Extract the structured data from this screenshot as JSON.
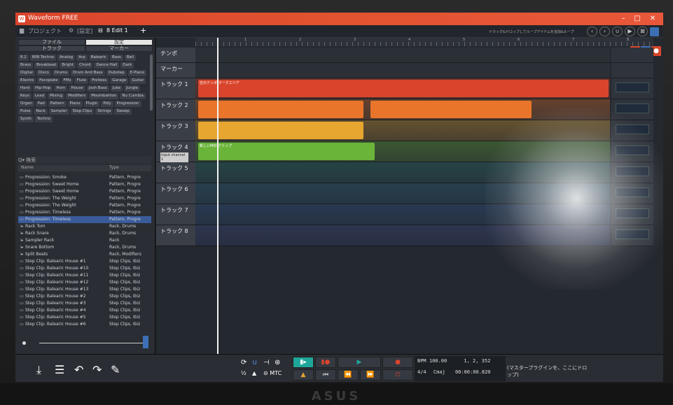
{
  "window": {
    "title": "Waveform FREE"
  },
  "toolbar": {
    "projects": "プロジェクト",
    "settings": "[設定]",
    "edit_tab": "8 Edit 1",
    "add": "+",
    "hint": "ドラッグ&ドロップしてループアイテムを追加&ループ"
  },
  "browser": {
    "tabs_top": [
      "ファイル",
      "設定"
    ],
    "tabs_bottom": [
      "トラック",
      "マーカー"
    ],
    "tags": [
      "8.2",
      "808 Techno",
      "Analog",
      "Arp",
      "Balearic",
      "Bass",
      "Bell",
      "Brass",
      "Breakbeat",
      "Bright",
      "Chord",
      "Dance Hall",
      "Dark",
      "Digital",
      "Disco",
      "Drums",
      "Drum And Bass",
      "Dubstep",
      "E-Piano",
      "Electro",
      "Fecoplate",
      "FMs",
      "Flute",
      "Fretless",
      "Garage",
      "Guitar",
      "Hard",
      "Hip-Hop",
      "Horn",
      "House",
      "Josh Bass",
      "Juke",
      "Jungle",
      "Keys",
      "Lead",
      "Mixing",
      "Modifiers",
      "Moombahton",
      "Nu Cumbia",
      "Organ",
      "Pad",
      "Pattern",
      "Piano",
      "Plugin",
      "Poly",
      "Progression",
      "Pulse",
      "Rack",
      "Sampler",
      "Step Clips",
      "Strings",
      "Sweep",
      "Synth",
      "Techno"
    ],
    "search_label": "検索",
    "columns": [
      "Name",
      "Type"
    ],
    "files": [
      {
        "icon": "pattern",
        "name": "Progression: Smoke",
        "type": "Pattern, Progre"
      },
      {
        "icon": "pattern",
        "name": "Progression: Sweet Home",
        "type": "Pattern, Progre"
      },
      {
        "icon": "pattern",
        "name": "Progression: Sweet Home",
        "type": "Pattern, Progre"
      },
      {
        "icon": "pattern",
        "name": "Progression: The Weight",
        "type": "Pattern, Progre"
      },
      {
        "icon": "pattern",
        "name": "Progression: The Weight",
        "type": "Pattern, Progre"
      },
      {
        "icon": "pattern",
        "name": "Progression: Timeless",
        "type": "Pattern, Progre"
      },
      {
        "icon": "pattern",
        "name": "Progression: Timeless",
        "type": "Pattern, Progre"
      },
      {
        "icon": "rack",
        "name": "Rack Tom",
        "type": "Rack, Drums"
      },
      {
        "icon": "rack",
        "name": "Rack Snare",
        "type": "Rack, Drums"
      },
      {
        "icon": "rack",
        "name": "Sampler Rack",
        "type": "Rack"
      },
      {
        "icon": "rack",
        "name": "Snare Bottom",
        "type": "Rack, Drums"
      },
      {
        "icon": "rack",
        "name": "Split Beats",
        "type": "Rack, Modifiers"
      },
      {
        "icon": "pattern",
        "name": "Step Clip: Balearic House #1",
        "type": "Step Clips, Ibiz"
      },
      {
        "icon": "pattern",
        "name": "Step Clip: Balearic House #10",
        "type": "Step Clips, Ibiz"
      },
      {
        "icon": "pattern",
        "name": "Step Clip: Balearic House #11",
        "type": "Step Clips, Ibiz"
      },
      {
        "icon": "pattern",
        "name": "Step Clip: Balearic House #12",
        "type": "Step Clips, Ibiz"
      },
      {
        "icon": "pattern",
        "name": "Step Clip: Balearic House #13",
        "type": "Step Clips, Ibiz"
      },
      {
        "icon": "pattern",
        "name": "Step Clip: Balearic House #2",
        "type": "Step Clips, Ibiz"
      },
      {
        "icon": "pattern",
        "name": "Step Clip: Balearic House #3",
        "type": "Step Clips, Ibiz"
      },
      {
        "icon": "pattern",
        "name": "Step Clip: Balearic House #4",
        "type": "Step Clips, Ibiz"
      },
      {
        "icon": "pattern",
        "name": "Step Clip: Balearic House #5",
        "type": "Step Clips, Ibiz"
      },
      {
        "icon": "pattern",
        "name": "Step Clip: Balearic House #6",
        "type": "Step Clips, Ibiz"
      }
    ],
    "selected_index": 6
  },
  "arrange": {
    "ruler_labels": [
      "1",
      "2",
      "3",
      "4",
      "5",
      "6",
      "7",
      "8"
    ],
    "tracks": [
      {
        "name": "テンポ",
        "color": "#3a3e46"
      },
      {
        "name": "マーカー",
        "color": "#3a3e46"
      },
      {
        "name": "トラック 1",
        "color": "#d9452c",
        "clip_label": "空のテンポ/マークエリア"
      },
      {
        "name": "トラック 2",
        "color": "#e8752a"
      },
      {
        "name": "トラック 3",
        "color": "#e6a630"
      },
      {
        "name": "トラック 4",
        "color": "#6ab43a",
        "clip_label": "新しいMIDIクリップ",
        "input": "Input channel 1"
      },
      {
        "name": "トラック 5",
        "color": "#2c7a73"
      },
      {
        "name": "トラック 6",
        "color": "#2e6b8e"
      },
      {
        "name": "トラック 7",
        "color": "#2f5a94"
      },
      {
        "name": "トラック 8",
        "color": "#3e4d8e"
      }
    ]
  },
  "transport": {
    "bpm_label": "BPM",
    "bpm": "100.00",
    "position": "1, 2, 352",
    "signature": "4/4",
    "key": "Cmaj",
    "time": "00:00:00.820",
    "plugin_drop": "(マスタープラグインを、ここにドロップ)"
  },
  "brand": "ASUS"
}
